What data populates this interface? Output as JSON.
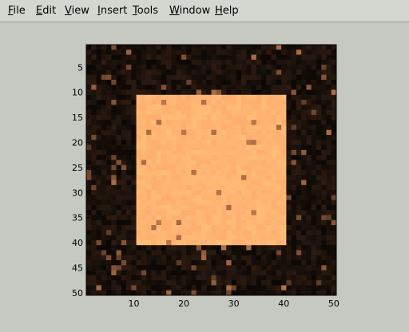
{
  "menu": {
    "items": [
      {
        "label": "File",
        "accel": "F",
        "rest": "ile"
      },
      {
        "label": "Edit",
        "accel": "E",
        "rest": "dit"
      },
      {
        "label": "View",
        "accel": "V",
        "rest": "iew"
      },
      {
        "label": "Insert",
        "accel": "I",
        "rest": "nsert"
      },
      {
        "label": "Tools",
        "accel": "T",
        "rest": "ools"
      },
      {
        "label": "Window",
        "accel": "W",
        "rest": "indow"
      },
      {
        "label": "Help",
        "accel": "H",
        "rest": "elp"
      }
    ]
  },
  "colors": {
    "window_bg": "#c6c9c2",
    "menubar_bg": "#d4d6d0",
    "square": "#fcb474",
    "background_dark": "#1a0f08"
  },
  "chart_data": {
    "type": "heatmap",
    "title": "",
    "xlabel": "",
    "ylabel": "",
    "xlim": [
      0.5,
      50.5
    ],
    "ylim": [
      0.5,
      50.5
    ],
    "y_reversed": true,
    "colormap": "copper",
    "xticks": [
      10,
      20,
      30,
      40,
      50
    ],
    "yticks": [
      5,
      10,
      15,
      20,
      25,
      30,
      35,
      40,
      45,
      50
    ],
    "grid_size": [
      50,
      50
    ],
    "bright_region": {
      "rows": [
        11,
        40
      ],
      "cols": [
        11,
        40
      ],
      "value": 0.95
    },
    "background_value": 0.08,
    "noise_level": 0.1
  }
}
